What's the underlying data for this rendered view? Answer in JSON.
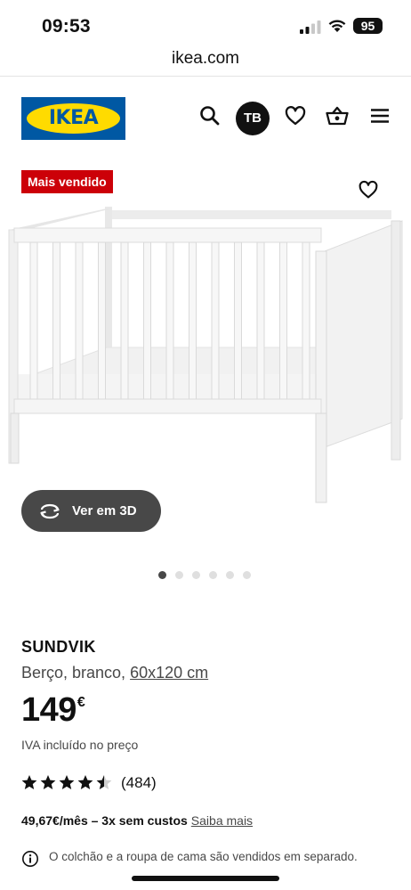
{
  "status_bar": {
    "time": "09:53",
    "battery": "95"
  },
  "browser": {
    "url": "ikea.com"
  },
  "header": {
    "logo_text": "IKEA",
    "avatar_initials": "TB"
  },
  "gallery": {
    "badge": "Mais vendido",
    "view_3d_label": "Ver em 3D",
    "image_count": 6,
    "active_image": 1
  },
  "product": {
    "name": "SUNDVIK",
    "description": "Berço, branco,",
    "size": "60x120 cm",
    "price": "149",
    "currency": "€",
    "vat_note": "IVA incluído no preço",
    "rating": 4.5,
    "rating_max": 5,
    "review_count": "(484)",
    "financing": "49,67€/mês – 3x sem custos",
    "financing_link": "Saiba mais",
    "info_note": "O colchão e a roupa de cama são vendidos em separado."
  },
  "colors": {
    "ikea_blue": "#0058a3",
    "ikea_yellow": "#ffdb00",
    "badge_red": "#cc0008",
    "dark_button": "#484848"
  },
  "icons": [
    "search-icon",
    "heart-icon",
    "basket-icon",
    "menu-icon",
    "rotate-3d-icon",
    "info-icon",
    "star-icon"
  ]
}
